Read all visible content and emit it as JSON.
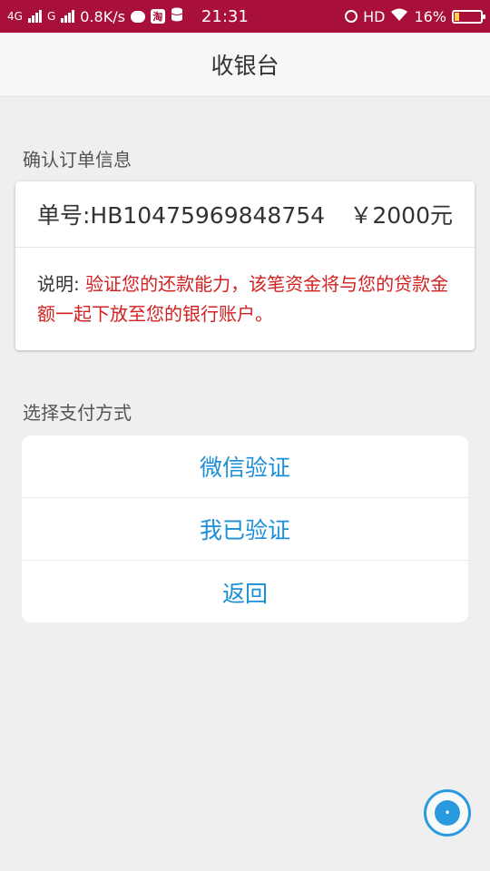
{
  "status_bar": {
    "network_1": "4G",
    "network_2": "G",
    "speed": "0.8K/s",
    "taobao_glyph": "淘",
    "time": "21:31",
    "hd": "HD",
    "battery": "16%",
    "icons": [
      "signal-icon",
      "chat-bubble-icon",
      "taobao-icon",
      "database-icon",
      "alarm-icon",
      "wifi-icon",
      "battery-icon"
    ]
  },
  "header": {
    "title": "收银台"
  },
  "order_section": {
    "label": "确认订单信息",
    "order_number": "单号:HB10475969848754",
    "amount": "￥2000元",
    "desc_prefix": "说明: ",
    "desc_text": "验证您的还款能力，该笔资金将与您的贷款金额一起下放至您的银行账户。"
  },
  "payment_section": {
    "label": "选择支付方式",
    "options": [
      {
        "label": "微信验证"
      },
      {
        "label": "我已验证"
      },
      {
        "label": "返回"
      }
    ]
  },
  "colors": {
    "status_bar": "#a8103a",
    "accent_blue": "#1b8fd8",
    "alert_red": "#d32020"
  }
}
